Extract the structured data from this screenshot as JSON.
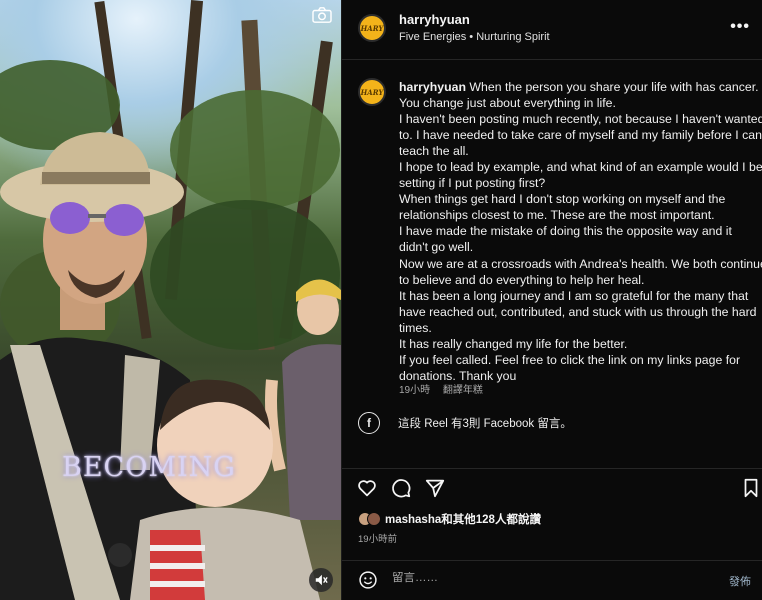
{
  "post": {
    "username": "harryhyuan",
    "subtitle": "Five Energies • Nurturing Spirit",
    "avatar_text": "HARY",
    "more_label": "•••",
    "caption_lines": [
      "When the person you share your life with has cancer.",
      "You change just about everything in life.",
      "I haven't been posting much recently, not because I haven't wanted",
      "to. I have needed to take care of myself and my family before I can",
      "teach the all.",
      "I hope to lead by example, and what kind of an example would I be",
      "setting if I put posting first?",
      "When things get hard I don't stop working on myself and the",
      "relationships closest to me. These are the most important.",
      "I have made the mistake of doing this the opposite way and it",
      "didn't go well.",
      "Now we are at a crossroads with Andrea's health. We both continue",
      "to believe and do everything to help her heal.",
      "It has been a long journey and I am so grateful for the many that",
      "have reached out, contributed, and stuck with us through the hard",
      "times.",
      "It has really changed my life for the better.",
      "If you feel called. Feel free to click the link on my links page for",
      "donations. Thank you"
    ],
    "caption_time": "19小時",
    "translate_label": "翻譯年糕",
    "facebook_note": "這段 Reel 有3則 Facebook 留言。",
    "likes_text": "mashasha和其他128人都說讚",
    "post_time": "19小時前",
    "comment_placeholder": "留言……",
    "post_button": "發佈",
    "video_overlay_text": "BECOMING"
  },
  "icons": {
    "camera": "camera-icon",
    "facebook": "facebook-icon",
    "like": "heart-icon",
    "comment": "comment-icon",
    "share": "share-icon",
    "save": "bookmark-icon",
    "emoji": "emoji-icon",
    "mute": "mute-icon"
  },
  "colors": {
    "brand_avatar": "#f3b31a",
    "background": "#0a0a0a",
    "secondary_text": "#a8a8a8"
  }
}
